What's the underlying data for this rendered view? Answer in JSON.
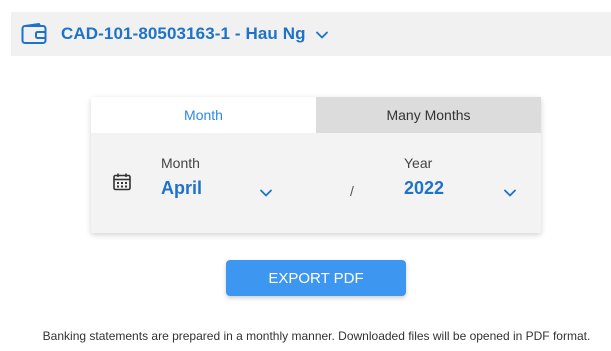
{
  "account": {
    "label": "CAD-101-80503163-1 - Hau Ng",
    "icon": "wallet-icon",
    "accent_color": "#1e73c8"
  },
  "tabs": [
    {
      "label": "Month",
      "active": true
    },
    {
      "label": "Many Months",
      "active": false
    }
  ],
  "picker": {
    "month_label": "Month",
    "month_value": "April",
    "separator": "/",
    "year_label": "Year",
    "year_value": "2022",
    "icon": "calendar-icon"
  },
  "export_button": {
    "label": "EXPORT PDF",
    "color": "#3d96f0"
  },
  "footnote": "Banking statements are prepared in a monthly manner. Downloaded files will be opened in PDF format."
}
